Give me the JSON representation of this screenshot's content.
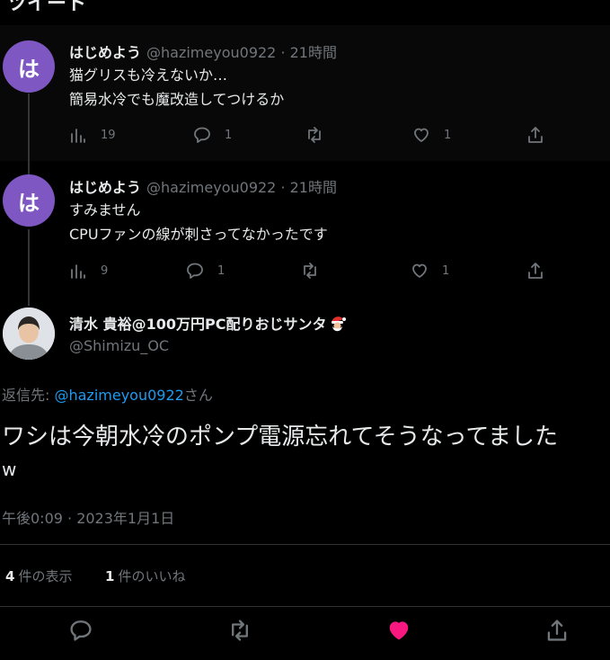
{
  "header": {
    "title": "ツイート"
  },
  "replies": [
    {
      "avatar_letter": "は",
      "name": "はじめよう",
      "meta": "@hazimeyou0922 · 21時間",
      "lines": [
        "猫グリスも冷えないか…",
        "簡易水冷でも魔改造してつけるか"
      ],
      "views": "19",
      "comments": "1",
      "likes": "1"
    },
    {
      "avatar_letter": "は",
      "name": "はじめよう",
      "meta": "@hazimeyou0922 · 21時間",
      "lines": [
        "すみません",
        "CPUファンの線が刺さってなかったです"
      ],
      "views": "9",
      "comments": "1",
      "likes": "1"
    }
  ],
  "main_tweet": {
    "name": "清水 貴裕@100万円PC配りおじサンタ",
    "handle": "@Shimizu_OC",
    "reply_to_prefix": "返信先: ",
    "reply_to_handle": "@hazimeyou0922",
    "reply_to_suffix": "さん",
    "text_line1": "ワシは今朝水冷のポンプ電源忘れてそうなってました",
    "text_line2": "w",
    "timestamp": "午後0:09 · 2023年1月1日",
    "quote_count": "4",
    "quote_label": "件の表示",
    "like_count": "1",
    "like_label": "件のいいね"
  },
  "colors": {
    "accent": "#1d9bf0",
    "like": "#f91880",
    "avatar": "#7e57c2"
  },
  "icons": [
    "views-icon",
    "reply-icon",
    "retweet-icon",
    "like-icon",
    "share-icon",
    "santa-icon"
  ]
}
